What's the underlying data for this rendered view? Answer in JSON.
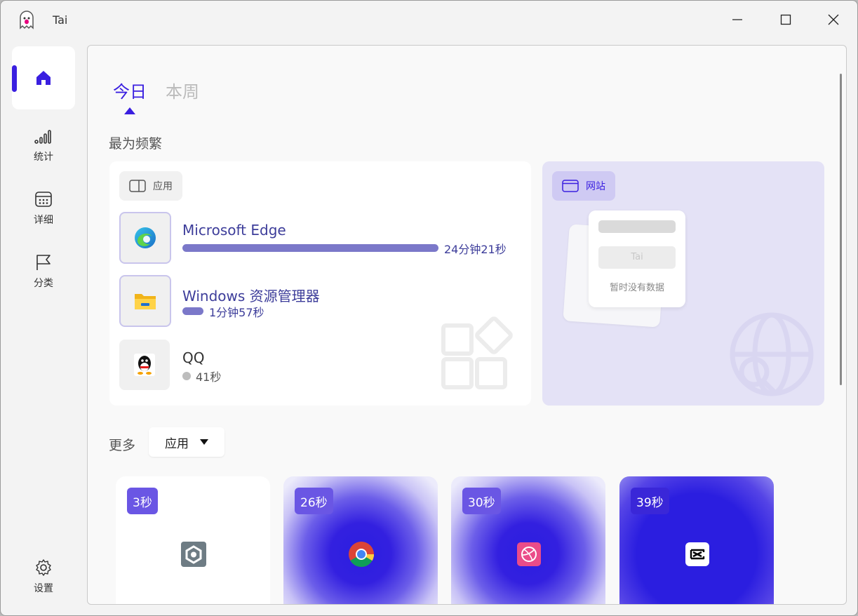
{
  "window": {
    "title": "Tai"
  },
  "sidebar": {
    "items": [
      {
        "label": "统计",
        "icon": "bar-chart-icon"
      },
      {
        "label": "详细",
        "icon": "calendar-icon"
      },
      {
        "label": "分类",
        "icon": "flag-icon"
      }
    ],
    "settings_label": "设置"
  },
  "tabs": [
    {
      "label": "今日",
      "active": true
    },
    {
      "label": "本周",
      "active": false
    }
  ],
  "frequent": {
    "title": "最为频繁",
    "apps_chip": "应用",
    "websites_chip": "网站",
    "apps": [
      {
        "name": "Microsoft Edge",
        "time": "24分钟21秒",
        "share": 1.0
      },
      {
        "name": "Windows 资源管理器",
        "time": "1分钟57秒",
        "share": 0.08
      },
      {
        "name": "QQ",
        "time": "41秒",
        "share": 0.0
      }
    ],
    "web_placeholder": {
      "name": "Tai",
      "empty_text": "暂时没有数据"
    }
  },
  "more": {
    "label": "更多",
    "dropdown_value": "应用",
    "tiles": [
      {
        "time": "3秒",
        "icon": "pix-app-icon"
      },
      {
        "time": "26秒",
        "icon": "chrome-icon"
      },
      {
        "time": "30秒",
        "icon": "dribbble-icon"
      },
      {
        "time": "39秒",
        "icon": "capcut-icon"
      }
    ]
  },
  "colors": {
    "accent": "#3a1fe0",
    "bar": "#7b78c9",
    "web_card": "#e4e2f6"
  }
}
